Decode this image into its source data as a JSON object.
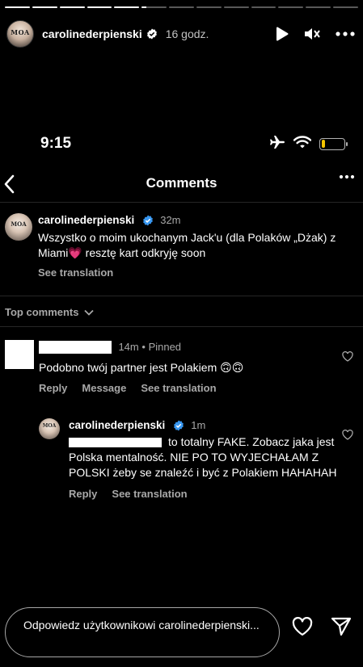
{
  "story": {
    "progress": [
      1,
      1,
      1,
      1,
      1,
      0.2,
      0,
      0,
      0,
      0,
      0,
      0,
      0
    ],
    "avatar_brand": "MOA",
    "username": "carolinederpienski",
    "time": "16 godz.",
    "icons": {
      "verified": "verified-badge-icon",
      "play": "play-icon",
      "mute": "mute-icon",
      "more": "more-icon"
    }
  },
  "status_bar": {
    "time": "9:15",
    "icons": [
      "airplane-icon",
      "wifi-icon",
      "battery-icon"
    ],
    "battery_level": 0.15,
    "battery_color": "#f4c400"
  },
  "nav": {
    "title": "Comments",
    "icons": {
      "back": "chevron-left-icon",
      "more": "more-icon"
    }
  },
  "caption": {
    "username": "carolinederpienski",
    "time": "32m",
    "text": "Wszystko o moim ukochanym Jack'u (dla Polaków „Dżak)  z Miami",
    "emoji": "💗",
    "text_after": " resztę kart odkryję soon",
    "see_translation": "See translation"
  },
  "sort": {
    "label": "Top comments",
    "icon": "chevron-down-icon"
  },
  "comment": {
    "time": "14m",
    "pinned": "Pinned",
    "separator": "•",
    "text": "Podobno twój partner jest Polakiem 🙃🙃",
    "actions": [
      "Reply",
      "Message",
      "See translation"
    ],
    "icon": "heart-outline-icon"
  },
  "reply": {
    "username": "carolinederpienski",
    "time": "1m",
    "text": "to totalny FAKE. Zobacz jaka jest Polska mentalność. NIE PO TO WYJECHAŁAM Z POLSKI żeby se znaleźć i być z Polakiem HAHAHAH",
    "actions": [
      "Reply",
      "See translation"
    ],
    "icon": "heart-outline-icon"
  },
  "composer": {
    "placeholder": "Odpowiedz użytkownikowi carolinederpienski...",
    "icons": {
      "like": "heart-outline-icon",
      "send": "send-icon"
    }
  },
  "colors": {
    "background": "#000000",
    "secondary_text": "#a8a8a8",
    "divider": "#262626",
    "verified": "#3897f0"
  }
}
